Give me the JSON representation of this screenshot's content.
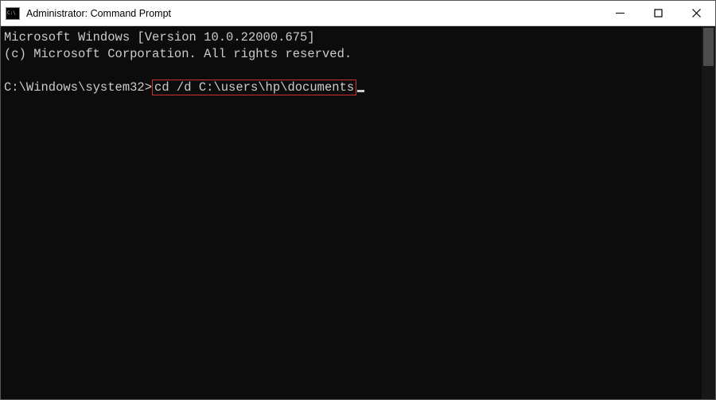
{
  "titlebar": {
    "title": "Administrator: Command Prompt"
  },
  "terminal": {
    "line1": "Microsoft Windows [Version 10.0.22000.675]",
    "line2": "(c) Microsoft Corporation. All rights reserved.",
    "prompt": "C:\\Windows\\system32>",
    "command": "cd /d C:\\users\\hp\\documents"
  }
}
